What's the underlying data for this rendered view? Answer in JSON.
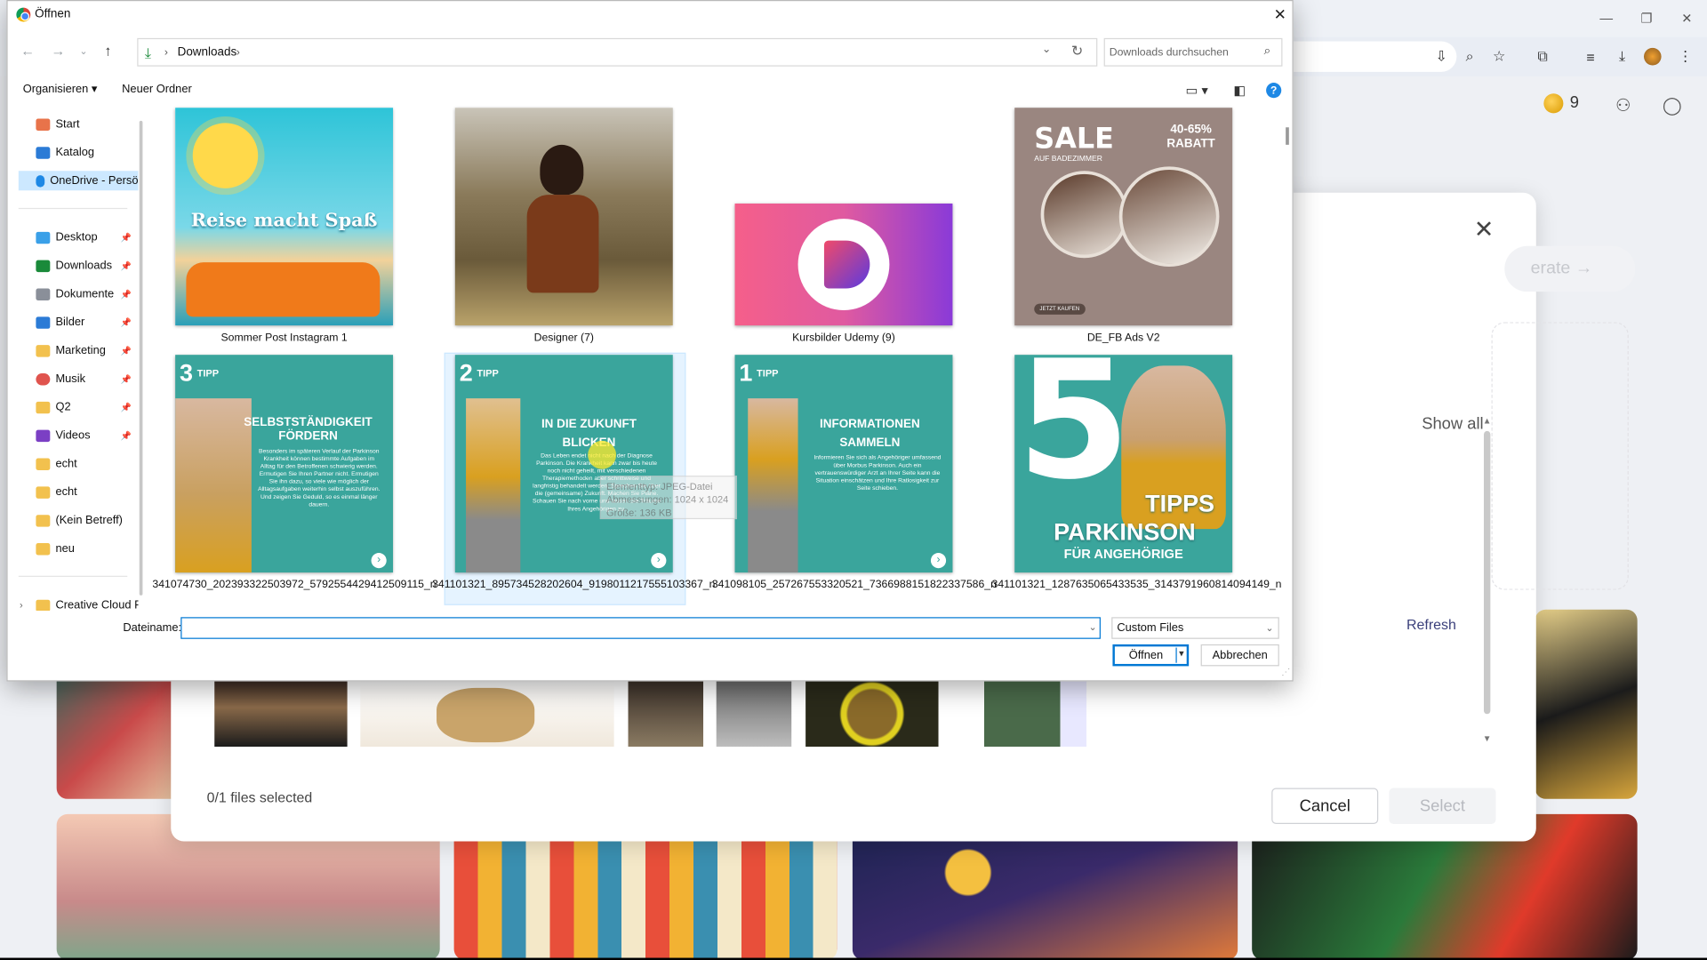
{
  "window": {
    "minimize": "—",
    "restore": "❐",
    "close": "✕"
  },
  "browser_toolbar": {
    "icons": [
      "install-icon",
      "zoom-icon",
      "star-icon",
      "extensions-icon",
      "media-icon",
      "download-icon",
      "profile-icon",
      "menu-icon"
    ]
  },
  "app_header": {
    "coins": "9"
  },
  "modal": {
    "partial_button": "erate →",
    "show_all": "Show all",
    "refresh": "Refresh",
    "files_selected": "0/1 files selected",
    "cancel": "Cancel",
    "select": "Select"
  },
  "dialog": {
    "title": "Öffnen",
    "close": "✕",
    "path": "Downloads",
    "search_placeholder": "Downloads durchsuchen",
    "organize": "Organisieren ▾",
    "new_folder": "Neuer Ordner",
    "nav": [
      {
        "label": "Start",
        "color": "#e8734a"
      },
      {
        "label": "Katalog",
        "color": "#2b7bd6"
      },
      {
        "label": "OneDrive - Persö",
        "color": "#1e88e5"
      },
      {
        "label": "Desktop",
        "color": "#3aa0e8"
      },
      {
        "label": "Downloads",
        "color": "#1a8a3a"
      },
      {
        "label": "Dokumente",
        "color": "#8a8f99"
      },
      {
        "label": "Bilder",
        "color": "#2b7bd6"
      },
      {
        "label": "Marketing",
        "color": "#f2c14e"
      },
      {
        "label": "Musik",
        "color": "#e0544e"
      },
      {
        "label": "Q2",
        "color": "#f2c14e"
      },
      {
        "label": "Videos",
        "color": "#7b3fc4"
      },
      {
        "label": "echt",
        "color": "#f2c14e"
      },
      {
        "label": "echt",
        "color": "#f2c14e"
      },
      {
        "label": "(Kein Betreff)",
        "color": "#f2c14e"
      },
      {
        "label": "neu",
        "color": "#f2c14e"
      },
      {
        "label": "Creative Cloud F",
        "color": "#f2c14e"
      }
    ],
    "files": [
      {
        "name": "Sommer Post Instagram 1",
        "overlay": "Reise macht Spaß"
      },
      {
        "name": "Designer (7)",
        "overlay": ""
      },
      {
        "name": "Kursbilder Udemy (9)",
        "overlay": ""
      },
      {
        "name": "DE_FB Ads V2",
        "overlay": "SALE",
        "overlay2": "40-65% RABATT",
        "overlay3": "AUF BADEZIMMER",
        "overlay4": "JETZT KAUFEN"
      },
      {
        "name": "341074730_202393322503972_5792554429412509115_n",
        "tip": "3",
        "tip_word": "TIPP",
        "heading": "SELBSTSTÄNDIGKEIT FÖRDERN",
        "body": "Besonders im späteren Verlauf der Parkinson Krankheit können bestimmte Aufgaben im Alltag für den Betroffenen schwierig werden. Ermutigen Sie Ihren Partner nicht. Ermutigen Sie ihn dazu, so viele wie möglich der Alltagsaufgaben weiterhin selbst auszuführen. Und zeigen Sie Geduld, so es einmal länger dauern."
      },
      {
        "name": "341101321_895734528202604_9198011217555103367_n",
        "tip": "2",
        "tip_word": "TIPP",
        "heading": "IN DIE ZUKUNFT BLICKEN",
        "body": "Das Leben endet nicht nach der Diagnose Parkinson. Die Krankheit kann zwar bis heute noch nicht geheilt, mit verschiedenen Therapiemethoden aber schrittweise und langfristig behandelt werden. Sprechen Sie über die (gemeinsame) Zukunft. Machen Sie Pläne. Schauen Sie nach vorne und lassen Sie Träume Ihres Angehörigen zu."
      },
      {
        "name": "341098105_257267553320521_7366988151822337586_n",
        "tip": "1",
        "tip_word": "TIPP",
        "heading": "INFORMATIONEN SAMMELN",
        "body": "Informieren Sie sich als Angehöriger umfassend über Morbus Parkinson. Auch ein vertrauenswürdiger Arzt an Ihrer Seite kann die Situation einschätzen und Ihre Ratlosigkeit zur Seite schieben."
      },
      {
        "name": "341101321_1287635065433535_3143791960814094149_n",
        "overlay": "5",
        "overlay2": "TIPPS",
        "overlay3": "PARKINSON",
        "overlay4": "FÜR ANGEHÖRIGE"
      }
    ],
    "tooltip": [
      "Elementtyp: JPEG-Datei",
      "Abmessungen: 1024 x 1024",
      "Größe: 136 KB"
    ],
    "filename_label": "Dateiname:",
    "filename_value": "",
    "filetype": "Custom Files",
    "open": "Öffnen",
    "cancel": "Abbrechen"
  },
  "colors": {
    "accent": "#0078d4",
    "teal": "#3aa59c",
    "selection": "#cce8ff"
  }
}
